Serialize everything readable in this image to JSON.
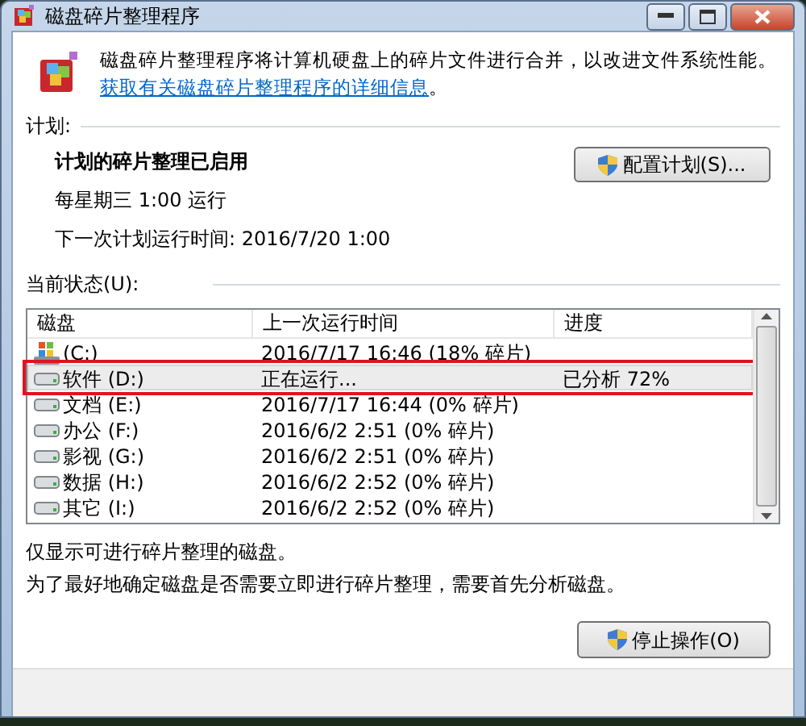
{
  "window": {
    "title": "磁盘碎片整理程序"
  },
  "intro": {
    "text": "磁盘碎片整理程序将计算机硬盘上的碎片文件进行合并，以改进文件系统性能。",
    "link": "获取有关磁盘碎片整理程序的详细信息",
    "end": "。"
  },
  "schedule": {
    "heading": "计划:",
    "status": "计划的碎片整理已启用",
    "frequency": "每星期三  1:00 运行",
    "next_run": "下一次计划运行时间: 2016/7/20 1:00",
    "button": "配置计划(S)..."
  },
  "current_status": {
    "heading": "当前状态(U):",
    "table": {
      "columns": [
        "磁盘",
        "上一次运行时间",
        "进度"
      ],
      "rows": [
        {
          "kind": "system",
          "disk": "(C:)",
          "last_run": "2016/7/17 16:46 (18% 碎片)",
          "progress": "",
          "selected": false,
          "annotated": false
        },
        {
          "kind": "drive",
          "disk": "软件 (D:)",
          "last_run": "正在运行...",
          "progress": "已分析 72%",
          "selected": true,
          "annotated": true
        },
        {
          "kind": "drive",
          "disk": "文档 (E:)",
          "last_run": "2016/7/17 16:44 (0% 碎片)",
          "progress": "",
          "selected": false,
          "annotated": false
        },
        {
          "kind": "drive",
          "disk": "办公 (F:)",
          "last_run": "2016/6/2 2:51 (0% 碎片)",
          "progress": "",
          "selected": false,
          "annotated": false
        },
        {
          "kind": "drive",
          "disk": "影视 (G:)",
          "last_run": "2016/6/2 2:51 (0% 碎片)",
          "progress": "",
          "selected": false,
          "annotated": false
        },
        {
          "kind": "drive",
          "disk": "数据 (H:)",
          "last_run": "2016/6/2 2:52 (0% 碎片)",
          "progress": "",
          "selected": false,
          "annotated": false
        },
        {
          "kind": "drive",
          "disk": "其它 (I:)",
          "last_run": "2016/6/2 2:52 (0% 碎片)",
          "progress": "",
          "selected": false,
          "annotated": false
        }
      ]
    }
  },
  "notes": [
    "仅显示可进行碎片整理的磁盘。",
    "为了最好地确定磁盘是否需要立即进行碎片整理，需要首先分析磁盘。"
  ],
  "action_button": "停止操作(O)"
}
